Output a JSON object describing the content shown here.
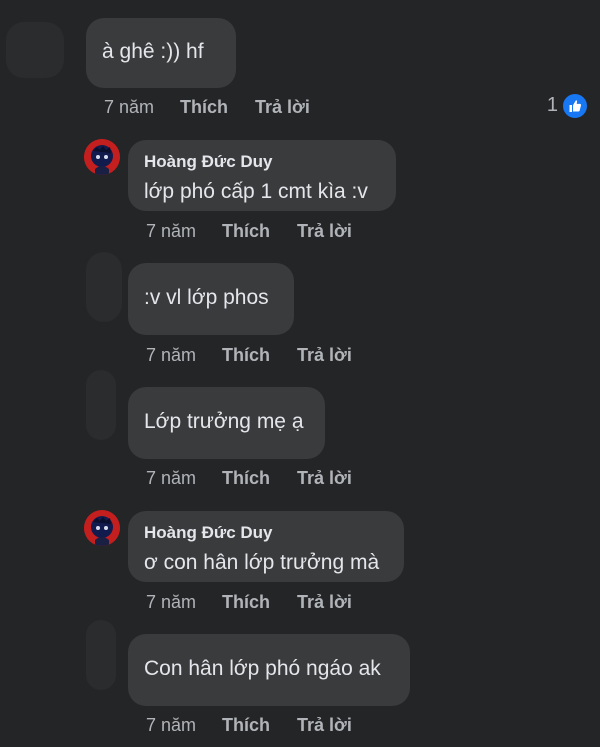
{
  "comments": [
    {
      "text": "à ghê :)) hf",
      "time": "7 năm",
      "like": "Thích",
      "reply": "Trả lời",
      "reaction_count": "1"
    },
    {
      "author": "Hoàng Đức Duy",
      "text": "lớp phó cấp 1 cmt kìa :v",
      "time": "7 năm",
      "like": "Thích",
      "reply": "Trả lời"
    },
    {
      "text": ":v vl lớp phos",
      "time": "7 năm",
      "like": "Thích",
      "reply": "Trả lời"
    },
    {
      "text": "Lớp trưởng mẹ ạ",
      "time": "7 năm",
      "like": "Thích",
      "reply": "Trả lời"
    },
    {
      "author": "Hoàng Đức Duy",
      "text": "ơ con hân lớp trưởng mà",
      "time": "7 năm",
      "like": "Thích",
      "reply": "Trả lời"
    },
    {
      "text": "Con hân lớp phó ngáo ak",
      "time": "7 năm",
      "like": "Thích",
      "reply": "Trả lời"
    }
  ],
  "icons": {
    "reaction": "like-icon",
    "avatar": "user-avatar"
  },
  "colors": {
    "background": "#242526",
    "bubble": "#3a3b3c",
    "meta_text": "#b0b3b8",
    "like_blue": "#1877f2"
  }
}
